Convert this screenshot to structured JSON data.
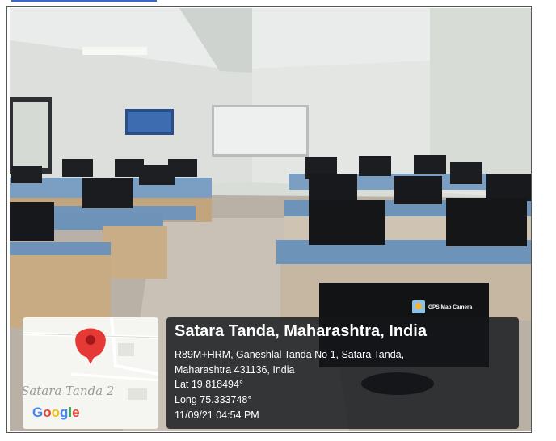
{
  "location": {
    "title": "Satara Tanda, Maharashtra, India",
    "address_line1": "R89M+HRM, Ganeshlal Tanda No 1, Satara Tanda,",
    "address_line2": "Maharashtra 431136, India",
    "lat": "Lat 19.818494°",
    "long": "Long 75.333748°",
    "datetime": "11/09/21 04:54 PM"
  },
  "map": {
    "place_label": "Satara Tanda 2",
    "brand_letters": [
      "G",
      "o",
      "o",
      "g",
      "l",
      "e"
    ]
  },
  "badge": {
    "label": "GPS Map Camera"
  },
  "colors": {
    "pin": "#e53935",
    "overlay": "#16181c",
    "desk_top": "#6d93b8"
  }
}
